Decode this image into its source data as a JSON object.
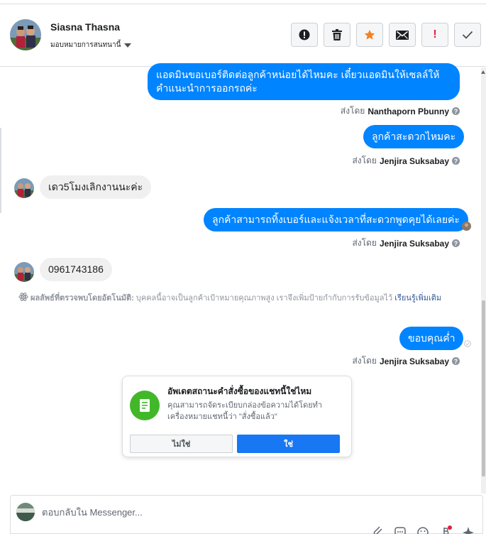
{
  "header": {
    "contact_name": "Siasna Thasna",
    "assign_label": "มอบหมายการสนทนานี้"
  },
  "actions": [
    {
      "name": "mark-spam-button",
      "icon": "alert-circle-icon"
    },
    {
      "name": "delete-button",
      "icon": "trash-icon"
    },
    {
      "name": "star-button",
      "icon": "star-icon"
    },
    {
      "name": "mark-unread-button",
      "icon": "envelope-icon"
    },
    {
      "name": "follow-up-button",
      "icon": "exclamation-icon",
      "glyph": "!"
    },
    {
      "name": "mark-done-button",
      "icon": "checkmark-icon"
    }
  ],
  "colors": {
    "accent": "#0084ff",
    "star": "#f5821f",
    "followup": "#e41e3f",
    "success": "#42b72a"
  },
  "thread": {
    "msg1": {
      "text": "แอดมินขอเบอร์ติดต่อลูกค้าหน่อยได้ไหมคะ เดี๋ยวแอดมินให้เซลล์ให้คำแนะนำการออกรถค่ะ",
      "sent_by_prefix": "ส่งโดย",
      "sender": "Nanthaporn Pbunny"
    },
    "msg2": {
      "text": "ลูกค้าสะดวกไหมคะ",
      "sent_by_prefix": "ส่งโดย",
      "sender": "Jenjira Suksabay"
    },
    "msg3": {
      "text": "เดว5โมงเลิกงานนะค่ะ"
    },
    "msg4": {
      "text": "ลูกค้าสามารถทิ้งเบอร์และแจ้งเวลาที่สะดวกพูดคุยได้เลยค่ะ",
      "sent_by_prefix": "ส่งโดย",
      "sender": "Jenjira Suksabay"
    },
    "msg5": {
      "text": "0961743186"
    },
    "auto_detect": {
      "label": "ผลลัพธ์ที่ตรวจพบโดยอัตโนมัติ:",
      "text": "บุคคลนี้อาจเป็นลูกค้าเป้าหมายคุณภาพสูง เราจึงเพิ่มป้ายกำกับการรับข้อมูลไว้",
      "link": "เรียนรู้เพิ่มเติม"
    },
    "msg6": {
      "text": "ขอบคุณค่ำ",
      "sent_by_prefix": "ส่งโดย",
      "sender": "Jenjira Suksabay"
    }
  },
  "prompt_card": {
    "title": "อัพเดตสถานะคำสั่งซื้อของแชทนี้ใช่ไหม",
    "description": "คุณสามารถจัดระเบียบกล่องข้อความได้โดยทำเครื่องหมายแชทนี้ว่า \"สั่งซื้อแล้ว\"",
    "no_label": "ไม่ใช่",
    "yes_label": "ใช่"
  },
  "composer": {
    "placeholder": "ตอบกลับใน Messenger..."
  }
}
